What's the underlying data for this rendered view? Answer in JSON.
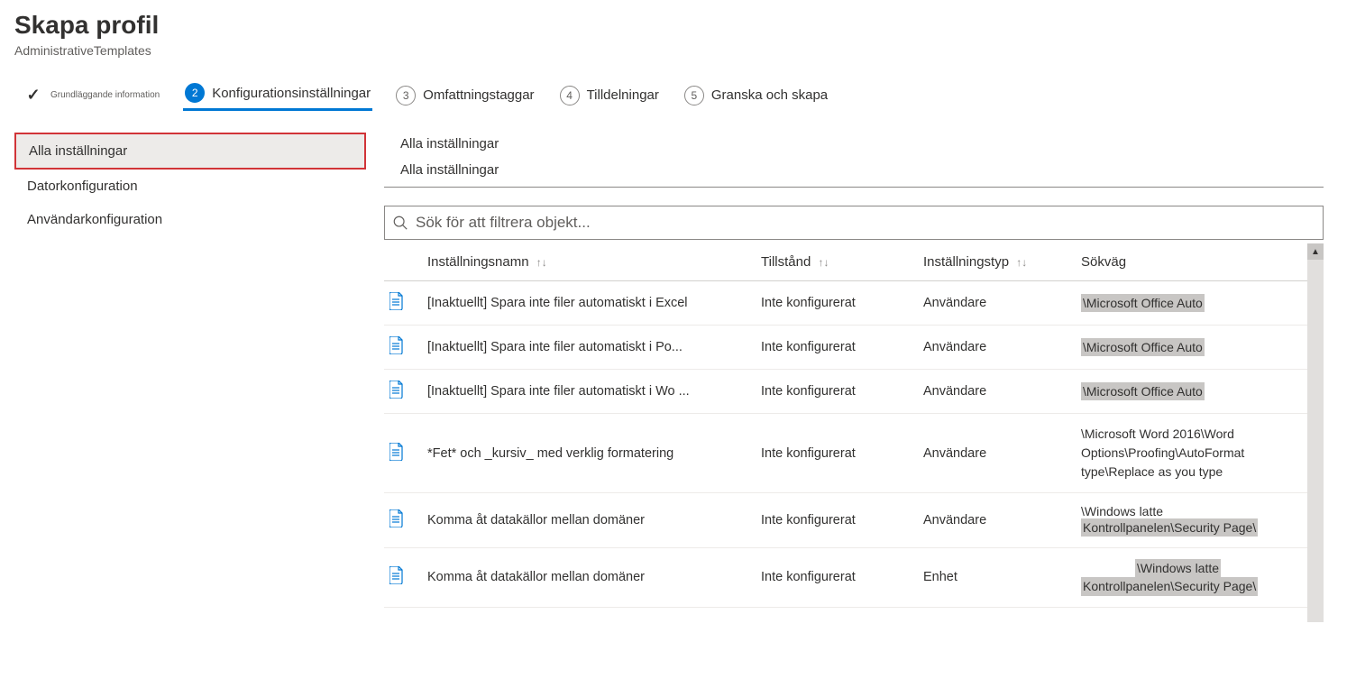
{
  "header": {
    "title": "Skapa profil",
    "subtitle": "AdministrativeTemplates"
  },
  "wizard": {
    "steps": [
      {
        "label": "Grundläggande information",
        "state": "done"
      },
      {
        "num": "2",
        "label": "Konfigurationsinställningar",
        "state": "current"
      },
      {
        "num": "3",
        "label": "Omfattningstaggar",
        "state": "future"
      },
      {
        "num": "4",
        "label": "Tilldelningar",
        "state": "future"
      },
      {
        "num": "5",
        "label": "Granska och skapa",
        "state": "future"
      }
    ]
  },
  "sidebar": {
    "items": [
      {
        "label": "Alla inställningar",
        "selected": true
      },
      {
        "label": "Datorkonfiguration",
        "selected": false
      },
      {
        "label": "Användarkonfiguration",
        "selected": false
      }
    ]
  },
  "main": {
    "breadcrumb1": "Alla inställningar",
    "breadcrumb2": "Alla inställningar",
    "search_placeholder": "Sök för att filtrera objekt...",
    "columns": {
      "name": "Inställningsnamn",
      "state": "Tillstånd",
      "type": "Inställningstyp",
      "path": "Sökväg"
    },
    "rows": [
      {
        "name_a": "[Inaktuellt] Spara inte filer automatiskt i ",
        "name_b": "Excel",
        "state": "Inte konfigurerat",
        "type": "Användare",
        "path_hl": "\\Microsoft Office Auto"
      },
      {
        "name_a": "[Inaktuellt] Spara inte filer automatiskt i ",
        "name_b": "Po...",
        "state": "Inte konfigurerat",
        "type": "Användare",
        "path_hl": "\\Microsoft Office Auto"
      },
      {
        "name_a": "[Inaktuellt] Spara inte filer automatiskt i Wo ...",
        "name_b": "",
        "state": "Inte konfigurerat",
        "type": "Användare",
        "path_hl": "\\Microsoft Office Auto"
      },
      {
        "name_a": "*Fet* och _kursiv_ med verklig formatering",
        "name_b": "",
        "state": "Inte konfigurerat",
        "type": "Användare",
        "path_multi": "\\Microsoft Word 2016\\Word Options\\Proofing\\AutoFormat type\\Replace as you type",
        "tall": true
      },
      {
        "name_a": "Komma åt datakällor mellan domäner",
        "name_b": "",
        "state": "Inte konfigurerat",
        "type": "Användare",
        "path_top": "\\Windows latte",
        "path_hl2": "Kontrollpanelen\\Security Page\\"
      },
      {
        "name_a": "Komma åt datakällor mellan domäner",
        "name_b": "",
        "state": "Inte konfigurerat",
        "type": "Enhet",
        "path_top_hl": "\\Windows latte",
        "path_hl2": "Kontrollpanelen\\Security Page\\"
      }
    ]
  }
}
